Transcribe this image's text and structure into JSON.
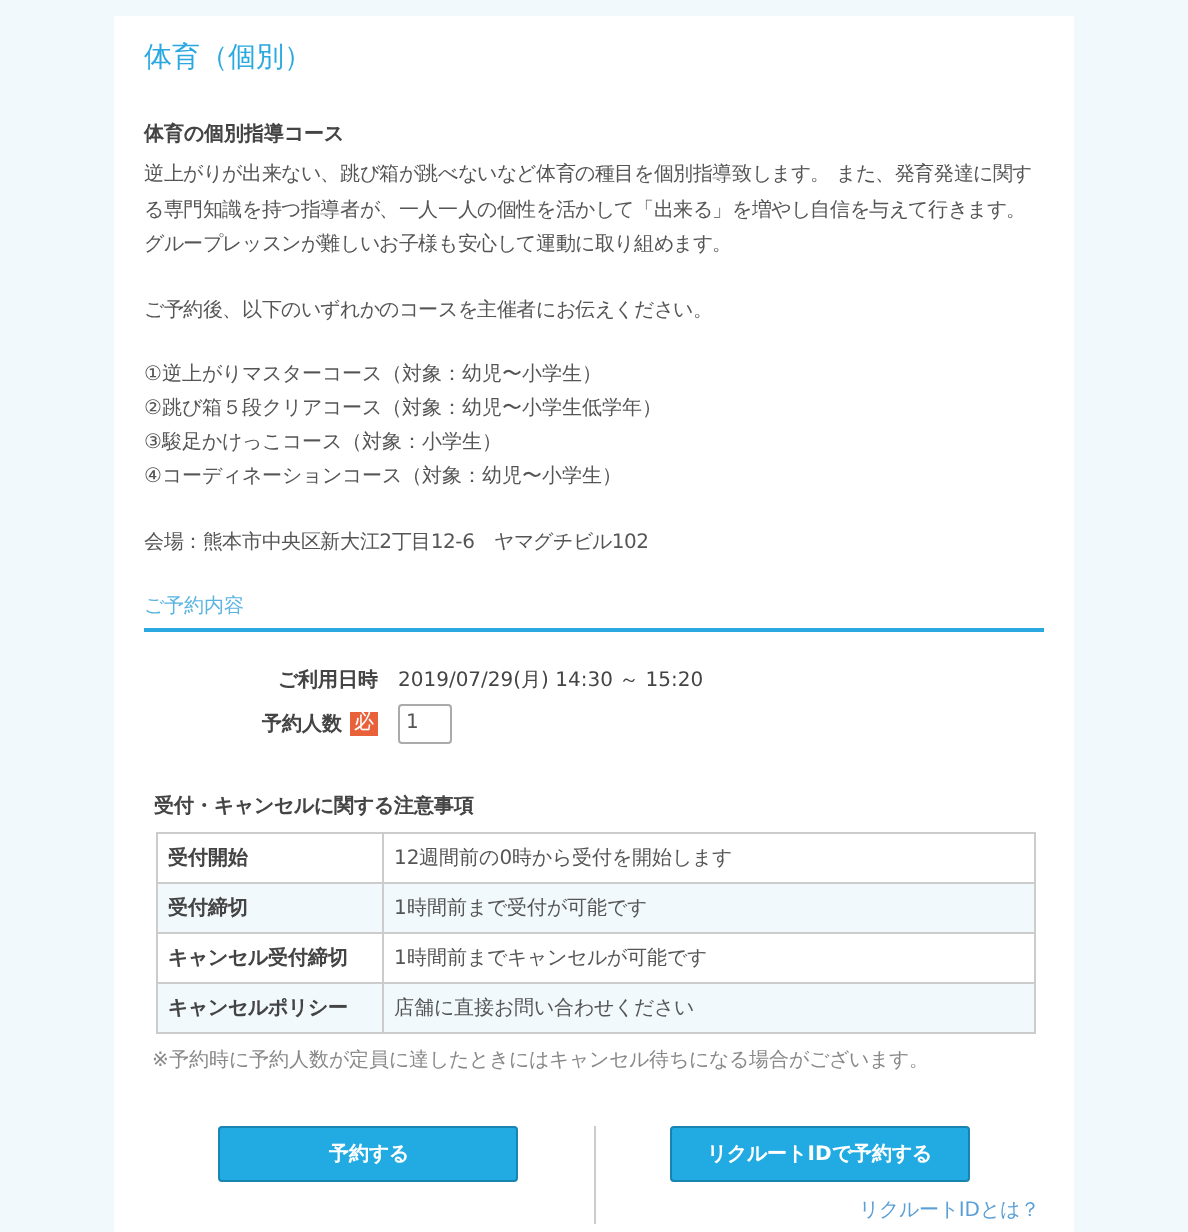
{
  "title": "体育（個別）",
  "course": {
    "heading": "体育の個別指導コース",
    "paragraphs": [
      "逆上がりが出来ない、跳び箱が跳べないなど体育の種目を個別指導致します。 また、発育発達に関する専門知識を持つ指導者が、一人一人の個性を活かして「出来る」を増やし自信を与えて行きます。グループレッスンが難しいお子様も安心して運動に取り組めます。",
      "ご予約後、以下のいずれかのコースを主催者にお伝えください。"
    ],
    "options": [
      "①逆上がりマスターコース（対象：幼児〜小学生）",
      "②跳び箱５段クリアコース（対象：幼児〜小学生低学年）",
      "③駿足かけっこコース（対象：小学生）",
      "④コーディネーションコース（対象：幼児〜小学生）"
    ],
    "venue": "会場：熊本市中央区新大江2丁目12-6　ヤマグチビル102"
  },
  "reservation": {
    "heading": "ご予約内容",
    "fields": [
      {
        "label": "ご利用日時",
        "kind": "text",
        "value": "2019/07/29(月) 14:30 ～ 15:20"
      },
      {
        "label": "予約人数",
        "kind": "input",
        "required_badge": "必",
        "value": "1"
      }
    ]
  },
  "notice": {
    "heading": "受付・キャンセルに関する注意事項",
    "rows": [
      {
        "label": "受付開始",
        "value": "12週間前の0時から受付を開始します"
      },
      {
        "label": "受付締切",
        "value": "1時間前まで受付が可能です"
      },
      {
        "label": "キャンセル受付締切",
        "value": "1時間前までキャンセルが可能です"
      },
      {
        "label": "キャンセルポリシー",
        "value": "店舗に直接お問い合わせください"
      }
    ],
    "footnote": "※予約時に予約人数が定員に達したときにはキャンセル待ちになる場合がございます。"
  },
  "buttons": [
    {
      "label": "予約する"
    },
    {
      "label": "リクルートIDで予約する",
      "link": "リクルートIDとは？"
    }
  ]
}
